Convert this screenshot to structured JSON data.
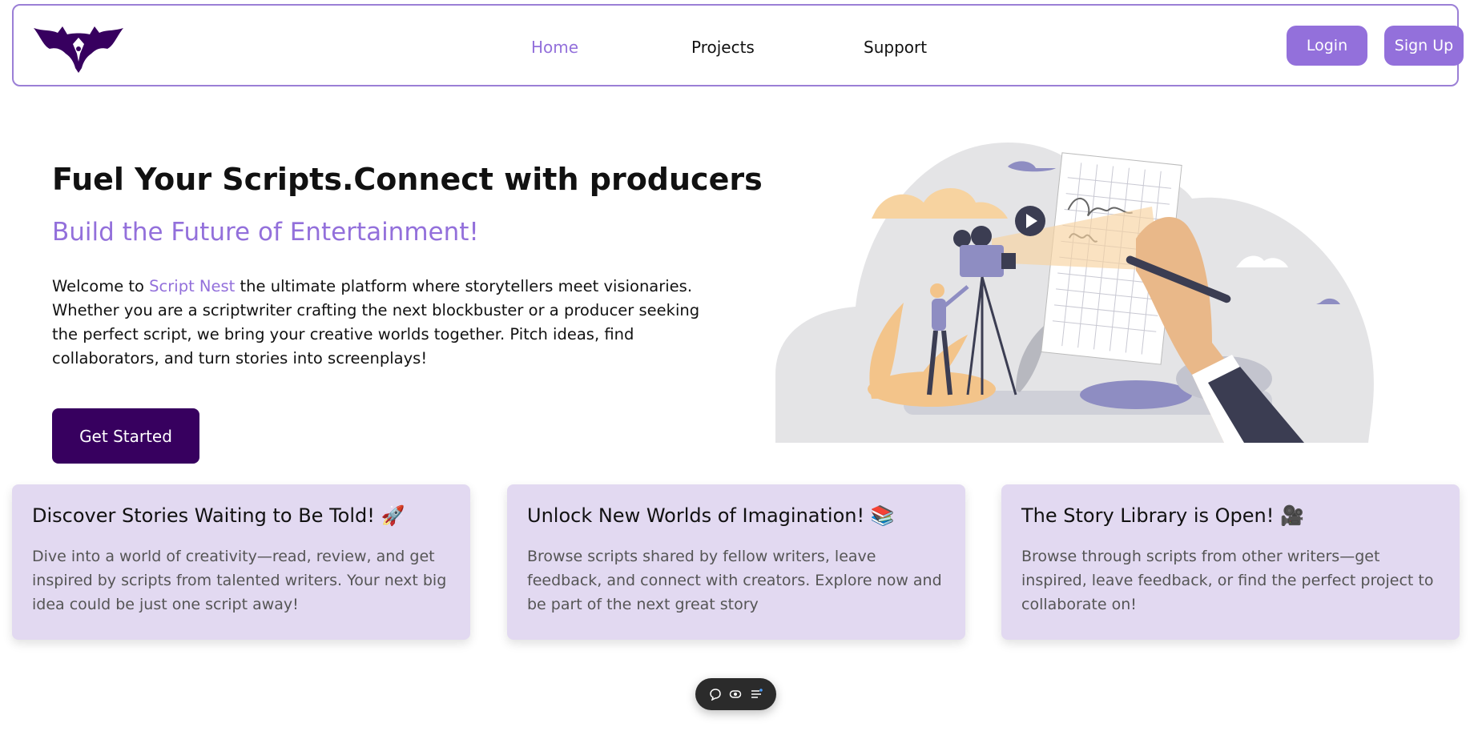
{
  "nav": {
    "links": [
      {
        "label": "Home",
        "active": true
      },
      {
        "label": "Projects",
        "active": false
      },
      {
        "label": "Support",
        "active": false
      }
    ],
    "login_label": "Login",
    "signup_label": "Sign Up"
  },
  "hero": {
    "title": "Fuel Your Scripts.Connect with producers",
    "subtitle": "Build the Future of Entertainment!",
    "desc_prefix": "Welcome to ",
    "brand": "Script Nest",
    "desc_suffix": " the ultimate platform where storytellers meet visionaries. Whether you are a scriptwriter crafting the next blockbuster or a producer seeking the perfect script, we bring your creative worlds together. Pitch ideas, find collaborators, and turn stories into screenplays!",
    "cta_label": "Get Started"
  },
  "cards": [
    {
      "title": "Discover Stories Waiting to Be Told! 🚀",
      "text": "Dive into a world of creativity—read, review, and get inspired by scripts from talented writers. Your next big idea could be just one script away!"
    },
    {
      "title": "Unlock New Worlds of Imagination! 📚",
      "text": "Browse scripts shared by fellow writers, leave feedback, and connect with creators. Explore now and be part of the next great story"
    },
    {
      "title": "The Story Library is Open! 🎥",
      "text": "Browse through scripts from other writers—get inspired, leave feedback, or find the perfect project to collaborate on!"
    }
  ],
  "colors": {
    "accent": "#9370db",
    "brand_dark": "#37005f",
    "card_bg": "#e2d9f1",
    "nav_border": "#9b7fd6"
  },
  "toolbar": {
    "icons": [
      "chat-icon",
      "eye-icon",
      "menu-icon"
    ]
  }
}
